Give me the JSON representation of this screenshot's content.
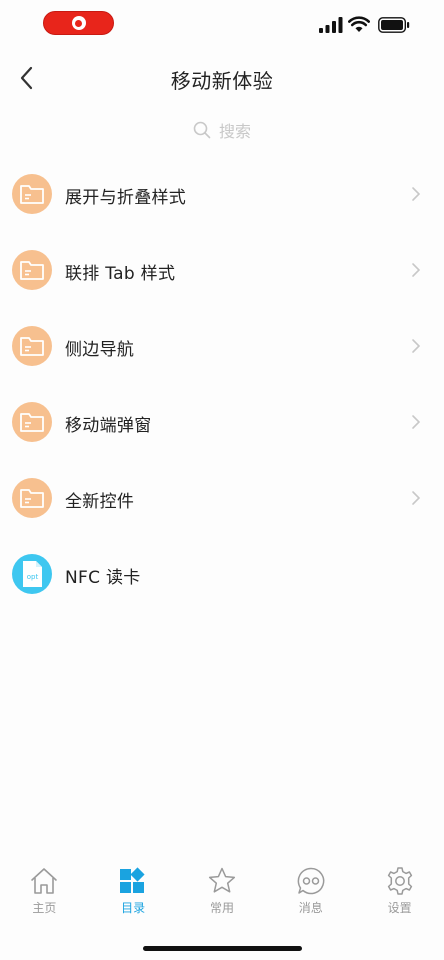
{
  "header": {
    "title": "移动新体验"
  },
  "search": {
    "placeholder": "搜索"
  },
  "menu": {
    "items": [
      {
        "label": "展开与折叠样式",
        "icon": "folder-icon"
      },
      {
        "label": "联排 Tab 样式",
        "icon": "folder-icon"
      },
      {
        "label": "侧边导航",
        "icon": "folder-icon"
      },
      {
        "label": "移动端弹窗",
        "icon": "folder-icon"
      },
      {
        "label": "全新控件",
        "icon": "folder-icon"
      },
      {
        "label": "NFC 读卡",
        "icon": "nfc-file-icon",
        "icon_text": "opt"
      }
    ]
  },
  "tabbar": {
    "items": [
      {
        "label": "主页",
        "icon": "home-icon",
        "active": false
      },
      {
        "label": "目录",
        "icon": "catalog-icon",
        "active": true
      },
      {
        "label": "常用",
        "icon": "star-icon",
        "active": false
      },
      {
        "label": "消息",
        "icon": "message-icon",
        "active": false
      },
      {
        "label": "设置",
        "icon": "settings-icon",
        "active": false
      }
    ]
  },
  "colors": {
    "accent": "#1aa3e0",
    "folder_icon_bg": "#f7c08f",
    "nfc_icon_bg": "#3ec7f0",
    "record_indicator": "#e8251b",
    "inactive_tab": "#9a9a9a"
  }
}
